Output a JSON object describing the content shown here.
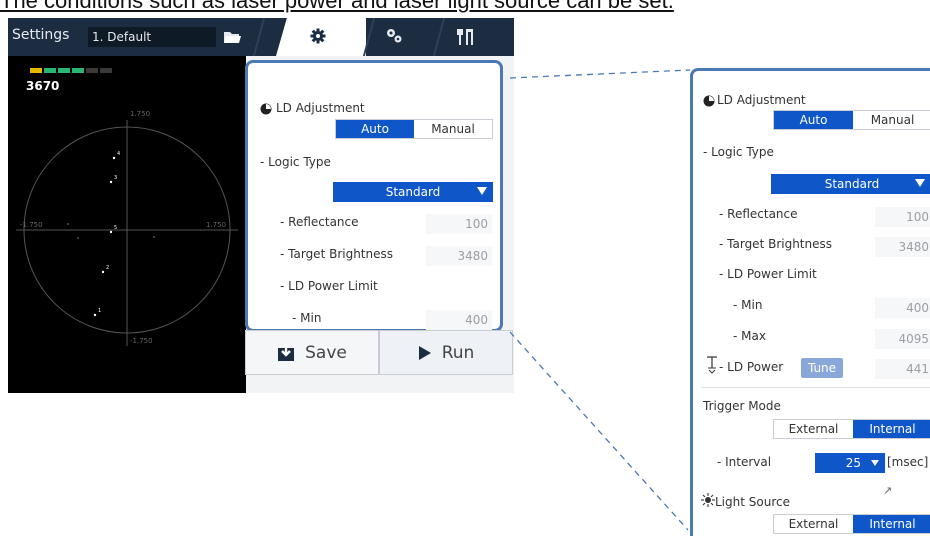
{
  "caption": "The conditions such as laser power and laser light source can be set.",
  "topbar": {
    "settings_label": "Settings",
    "profile_value": "1. Default",
    "icons": [
      "folder-icon",
      "gear-icon",
      "gears-icon",
      "tools-icon"
    ]
  },
  "viewer": {
    "readout": "3670",
    "level_segments_active": 4,
    "level_segments_total": 6,
    "axis_labels": {
      "top": "1.750",
      "left": "-1.750",
      "right": "1.750",
      "bottom": "-1.750"
    },
    "points": [
      "4",
      "3",
      "5",
      "2",
      "1"
    ]
  },
  "panel": {
    "ld_adjustment_label": "LD Adjustment",
    "mode_auto": "Auto",
    "mode_manual": "Manual",
    "logic_type_label": "- Logic Type",
    "logic_type_value": "Standard",
    "reflectance_label": "- Reflectance",
    "reflectance_value": "100",
    "target_brightness_label": "- Target Brightness",
    "target_brightness_value": "3480",
    "ld_power_limit_label": "- LD Power Limit",
    "min_label": "- Min",
    "min_value": "400"
  },
  "bottom": {
    "save_label": "Save",
    "run_label": "Run"
  },
  "zoom": {
    "ld_adjustment_label": "LD Adjustment",
    "mode_auto": "Auto",
    "mode_manual": "Manual",
    "logic_type_label": "- Logic Type",
    "logic_type_value": "Standard",
    "reflectance_label": "- Reflectance",
    "reflectance_value": "100",
    "target_brightness_label": "- Target Brightness",
    "target_brightness_value": "3480",
    "ld_power_limit_label": "- LD Power Limit",
    "min_label": "- Min",
    "min_value": "400",
    "max_label": "- Max",
    "max_value": "4095",
    "ld_power_label": "- LD Power",
    "tune_label": "Tune",
    "ld_power_value": "441",
    "trigger_mode_label": "Trigger Mode",
    "trigger_external": "External",
    "trigger_internal": "Internal",
    "interval_label": "- Interval",
    "interval_value": "25",
    "interval_unit": "[msec]",
    "light_source_label": "Light Source",
    "light_external": "External",
    "light_internal": "Internal"
  },
  "colors": {
    "accent": "#0f57c8",
    "frame": "#4a79b4",
    "topbar": "#1c2d42",
    "level_on": "#2bb673",
    "level_peak": "#e6b800"
  }
}
